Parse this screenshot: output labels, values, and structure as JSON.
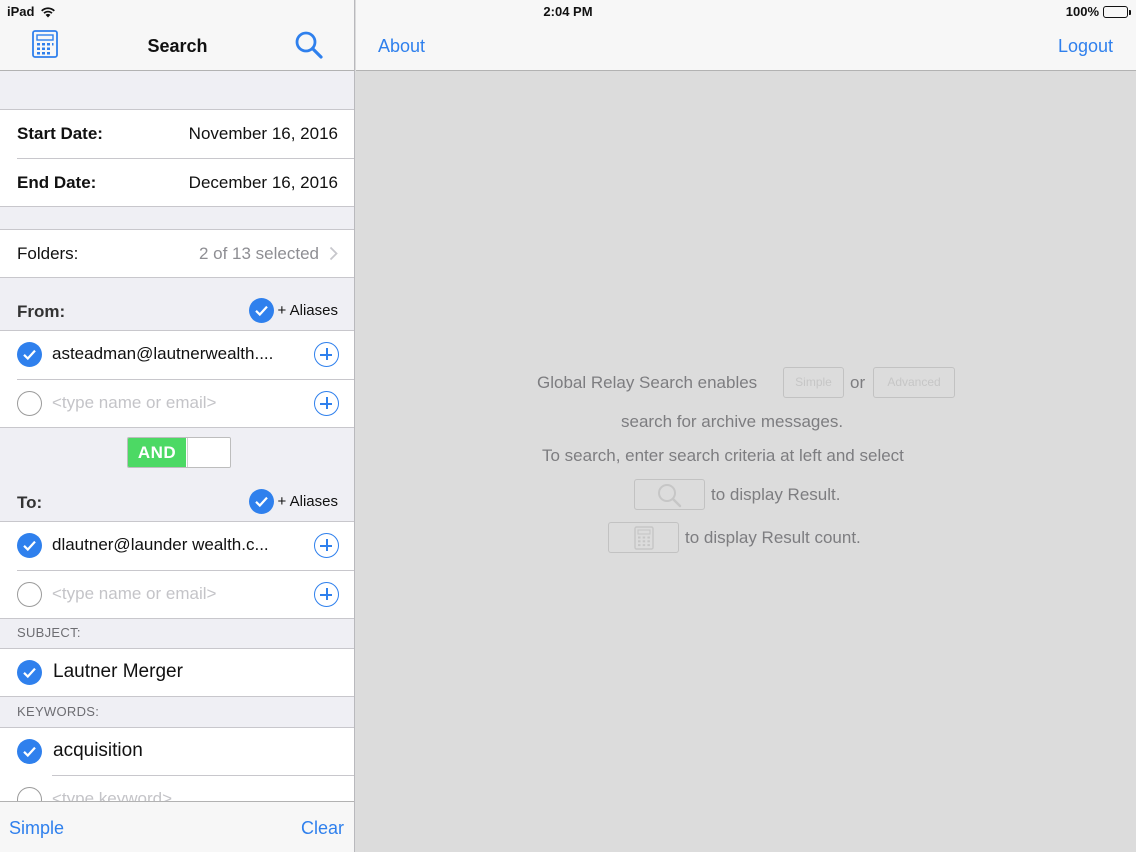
{
  "status": {
    "device": "iPad",
    "time": "2:04 PM",
    "battery": "100%"
  },
  "left_nav": {
    "title": "Search",
    "calculator_icon": "calculator-icon",
    "search_icon": "search-icon"
  },
  "dates": {
    "start_label": "Start Date:",
    "start_value": "November 16, 2016",
    "end_label": "End Date:",
    "end_value": "December 16, 2016"
  },
  "folders": {
    "label": "Folders:",
    "value": "2 of 13 selected"
  },
  "from": {
    "label": "From:",
    "aliases_label": "+ Aliases",
    "entry": "asteadman@lautnerwealth....",
    "placeholder": "<type name or email>"
  },
  "operator": {
    "label": "AND",
    "state": "on"
  },
  "to": {
    "label": "To:",
    "aliases_label": "+ Aliases",
    "entry": "dlautner@launder wealth.c...",
    "placeholder": "<type name or email>"
  },
  "subject": {
    "header": "SUBJECT:",
    "entry": "Lautner Merger"
  },
  "keywords": {
    "header": "KEYWORDS:",
    "entry": "acquisition",
    "placeholder": "<type keyword>"
  },
  "toolbar": {
    "simple": "Simple",
    "clear": "Clear"
  },
  "right_nav": {
    "about": "About",
    "logout": "Logout"
  },
  "help": {
    "line1_a": "Global Relay Search enables",
    "simple_button": "Simple",
    "or": "or",
    "advanced_button": "Advanced",
    "line2": "search for archive messages.",
    "line3": "To search, enter search criteria at left and select",
    "line4": "to display Result.",
    "line5": "to display Result count."
  },
  "colors": {
    "accent": "#2f80ed",
    "toggle_on": "#4cd964"
  }
}
